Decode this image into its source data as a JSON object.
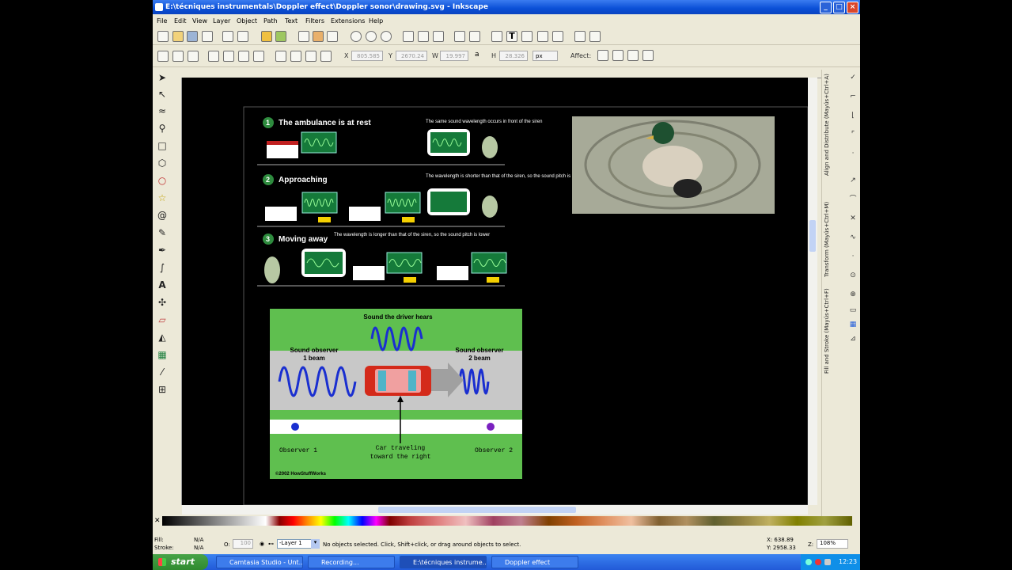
{
  "window": {
    "title": "E:\\técniques instrumentals\\Doppler effect\\Doppler sonor\\drawing.svg - Inkscape"
  },
  "menu": [
    "File",
    "Edit",
    "View",
    "Layer",
    "Object",
    "Path",
    "Text",
    "Filters",
    "Extensions",
    "Help"
  ],
  "toolcontrols": {
    "x_label": "X",
    "x_value": "805.585",
    "y_label": "Y",
    "y_value": "2670.24",
    "w_label": "W",
    "w_value": "19.997",
    "h_label": "H",
    "h_value": "28.326",
    "unit": "px",
    "affect_label": "Affect:"
  },
  "dock_tabs": [
    "Align and Distribute (Mayús+Ctrl+A)",
    "Transform (Mayús+Ctrl+M)",
    "Fill and Stroke (Mayús+Ctrl+F)"
  ],
  "canvas": {
    "s1_num": "1",
    "s1_title": "The ambulance is at rest",
    "s1_note": "The same sound wavelength occurs in front of the siren",
    "s2_num": "2",
    "s2_title": "Approaching",
    "s2_note": "The wavelength is shorter than that of the siren, so the sound pitch is higher",
    "s3_num": "3",
    "s3_title": "Moving away",
    "s3_note": "The wavelength is longer than that of the siren, so the sound pitch is lower",
    "driver_hears": "Sound the driver hears",
    "obs1_a": "Sound observer",
    "obs1_b": "1 beam",
    "obs2_a": "Sound observer",
    "obs2_b": "2 beam",
    "car_a": "Car traveling",
    "car_b": "toward the right",
    "observer1": "Observer 1",
    "observer2": "Observer 2",
    "copyright": "©2002 HowStuffWorks"
  },
  "statusbar": {
    "fill_label": "Fill:",
    "fill_value": "N/A",
    "stroke_label": "Stroke:",
    "stroke_value": "N/A",
    "opacity_label": "O:",
    "opacity_value": "100",
    "layer": "-Layer 1",
    "message": "No objects selected. Click, Shift+click, or drag around objects to select.",
    "x_coord": "X:  638.89",
    "y_coord": "Y: 2958.33",
    "zoom_label": "Z:",
    "zoom": "108%"
  },
  "taskbar": {
    "start": "start",
    "tasks": [
      "Camtasia Studio - Unt...",
      "Recording...",
      "E:\\técniques instrume...",
      "Doppler effect"
    ],
    "time": "12:23"
  },
  "colors": {
    "canvas_bg": "#000000",
    "figure_green": "#5fbf4f",
    "road": "#c8c8c8",
    "wave": "#1a2fd0",
    "xp_blue": "#245edb"
  }
}
